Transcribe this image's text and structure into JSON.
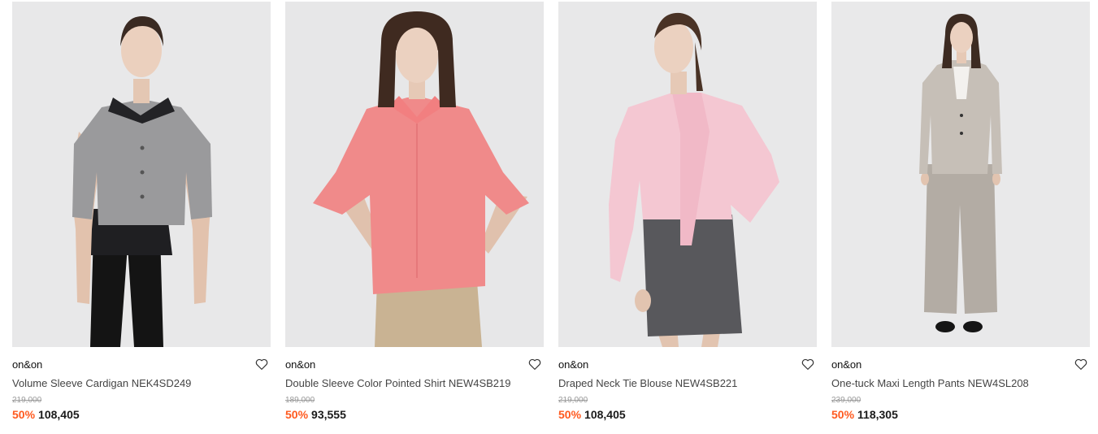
{
  "colors": {
    "discount": "#ff5a1f",
    "photo_bg": "#e9e9ea",
    "original_price": "#9a9a9a"
  },
  "products": [
    {
      "brand": "on&on",
      "name": "Volume Sleeve Cardigan NEK4SD249",
      "original_price": "219,000",
      "discount": "50%",
      "price": "108,405",
      "icon": "heart-icon"
    },
    {
      "brand": "on&on",
      "name": "Double Sleeve Color Pointed Shirt NEW4SB219",
      "original_price": "189,000",
      "discount": "50%",
      "price": "93,555",
      "icon": "heart-icon"
    },
    {
      "brand": "on&on",
      "name": "Draped Neck Tie Blouse NEW4SB221",
      "original_price": "219,000",
      "discount": "50%",
      "price": "108,405",
      "icon": "heart-icon"
    },
    {
      "brand": "on&on",
      "name": "One-tuck Maxi Length Pants NEW4SL208",
      "original_price": "239,000",
      "discount": "50%",
      "price": "118,305",
      "icon": "heart-icon"
    }
  ]
}
